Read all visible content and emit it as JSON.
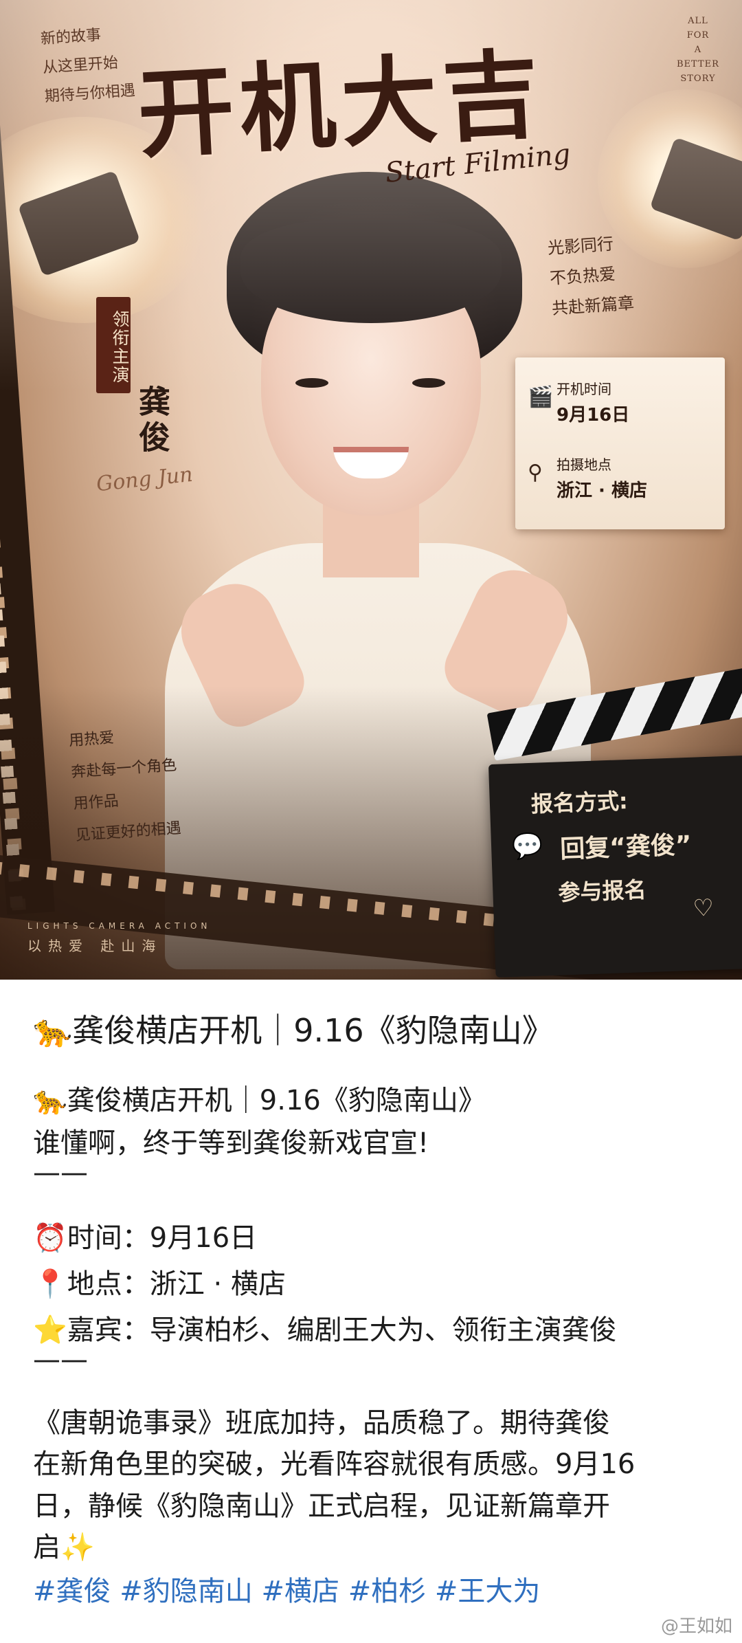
{
  "poster": {
    "tagline": [
      "新的故事",
      "从这里开始",
      "期待与你相遇"
    ],
    "story_tag": [
      "ALL",
      "FOR",
      "A",
      "BETTER",
      "STORY"
    ],
    "title_main": "开机大吉",
    "title_sub": "Start Filming",
    "lead_label": "领衔主演",
    "actor_name": "龚俊",
    "actor_signature": "Gong Jun",
    "right_tagline": [
      "光影同行",
      "不负热爱",
      "共赴新篇章"
    ],
    "info_card": {
      "time_label": "开机时间",
      "time_value": "9月16日",
      "place_label": "拍摄地点",
      "place_value": "浙江 · 横店"
    },
    "left_lower_tagline": [
      "用热爱",
      "奔赴每一个角色",
      "用作品",
      "见证更好的相遇"
    ],
    "footer_en": "LIGHTS  CAMERA  ACTION",
    "footer_cn": "以热爱 赴山海",
    "clapper": {
      "line1": "报名方式:",
      "line2": "回复“龚俊”",
      "line3": "参与报名"
    }
  },
  "post": {
    "title": "🐆龚俊横店开机｜9.16《豹隐南山》",
    "lines": [
      "🐆龚俊横店开机｜9.16《豹隐南山》",
      "谁懂啊，终于等到龚俊新戏官宣!",
      "——",
      "⏰时间：9月16日",
      "📍地点：浙江 · 横店",
      "⭐嘉宾：导演柏杉、编剧王大为、领衔主演龚俊",
      "——",
      "《唐朝诡事录》班底加持，品质稳了。期待龚俊",
      "在新角色里的突破，光看阵容就很有质感。9月16",
      "日，静候《豹隐南山》正式启程，见证新篇章开",
      "启✨"
    ],
    "hashtags": "#龚俊 #豹隐南山 #横店 #柏杉 #王大为",
    "watermark": "@王如如"
  },
  "colors": {
    "hashtag": "#2f6fbf",
    "poster_dark": "#3a1c12"
  }
}
